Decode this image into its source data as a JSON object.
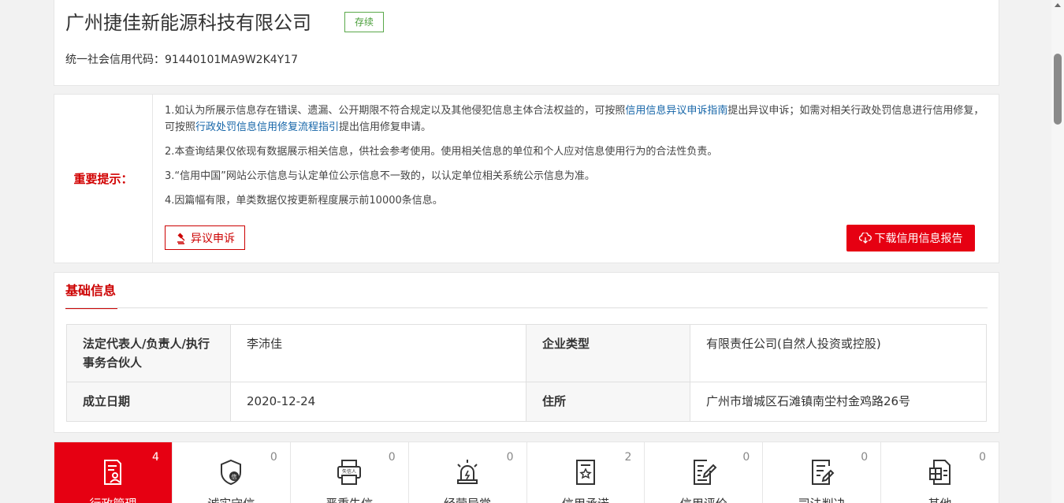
{
  "company": {
    "name": "广州捷佳新能源科技有限公司",
    "status": "存续",
    "credit_code_label": "统一社会信用代码：",
    "credit_code": "91440101MA9W2K4Y17"
  },
  "notice": {
    "title": "重要提示：",
    "line1_a": "1.如认为所展示信息存在错误、遗漏、公开期限不符合规定以及其他侵犯信息主体合法权益的，可按照",
    "line1_link1": "信用信息异议申诉指南",
    "line1_b": "提出异议申诉；如需对相关行政处罚信息进行信用修复，可按照",
    "line1_link2": "行政处罚信息信用修复流程指引",
    "line1_c": "提出信用修复申请。",
    "line2": "2.本查询结果仅依现有数据展示相关信息，供社会参考使用。使用相关信息的单位和个人应对信息使用行为的合法性负责。",
    "line3": "3.“信用中国”网站公示信息与认定单位公示信息不一致的，以认定单位相关系统公示信息为准。",
    "line4": "4.因篇幅有限，单类数据仅按更新程度展示前10000条信息。",
    "objection_button": "异议申诉",
    "download_button": "下载信用信息报告"
  },
  "basic_info": {
    "tab_title": "基础信息",
    "legal_rep_label": "法定代表人/负责人/执行事务合伙人",
    "legal_rep_value": "李沛佳",
    "type_label": "企业类型",
    "type_value": "有限责任公司(自然人投资或控股)",
    "date_label": "成立日期",
    "date_value": "2020-12-24",
    "address_label": "住所",
    "address_value": "广州市增城区石滩镇南坣村金鸡路26号"
  },
  "categories": [
    {
      "label": "行政管理",
      "count": "4",
      "icon": "document-person-icon"
    },
    {
      "label": "诚实守信",
      "count": "0",
      "icon": "shield-credit-icon"
    },
    {
      "label": "严重失信",
      "count": "0",
      "icon": "dishonest-printer-icon"
    },
    {
      "label": "经营异常",
      "count": "0",
      "icon": "alarm-light-icon"
    },
    {
      "label": "信用承诺",
      "count": "2",
      "icon": "promise-document-icon"
    },
    {
      "label": "信用评价",
      "count": "0",
      "icon": "evaluation-edit-icon"
    },
    {
      "label": "司法判决",
      "count": "0",
      "icon": "judgment-document-icon"
    },
    {
      "label": "其他",
      "count": "0",
      "icon": "other-files-icon"
    }
  ],
  "colors": {
    "accent_red": "#e60012",
    "status_green": "#4a9e3a",
    "link_blue": "#1565a8"
  }
}
